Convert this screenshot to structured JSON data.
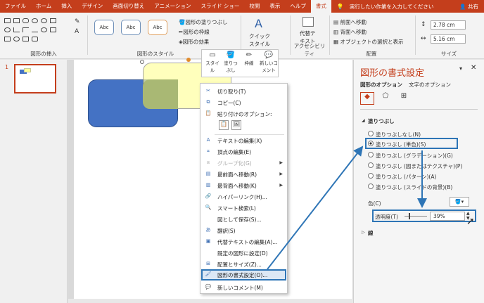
{
  "tabs": [
    "ファイル",
    "ホーム",
    "挿入",
    "デザイン",
    "画面切り替え",
    "アニメーション",
    "スライド ショー",
    "校閲",
    "表示",
    "ヘルプ",
    "書式"
  ],
  "tell_me": "実行したい作業を入力してください",
  "share": "共有",
  "ribbon": {
    "insert_group": "図形の挿入",
    "style_group": "図形のスタイル",
    "style_samples": [
      "Abc",
      "Abc",
      "Abc"
    ],
    "fill_btn": "図形の塗りつぶし",
    "outline_btn": "図形の枠線",
    "effect_btn": "図形の効果",
    "quick_style": "クイック\nスタイル",
    "alt_text": "代替テ\nキスト",
    "access_group": "アクセシビリティ",
    "forward": "前面へ移動",
    "backward": "背面へ移動",
    "select_pane": "オブジェクトの選択と表示",
    "arrange_group": "配置",
    "height": "2.78 cm",
    "width": "5.16 cm",
    "size_group": "サイズ"
  },
  "thumb_number": "1",
  "mini_toolbar": [
    "スタイル",
    "塗りつぶし",
    "枠線",
    "新しいコメント"
  ],
  "context_menu": {
    "cut": "切り取り(T)",
    "copy": "コピー(C)",
    "paste_opts": "貼り付けのオプション:",
    "edit_text": "テキストの編集(X)",
    "edit_points": "頂点の編集(E)",
    "group": "グループ化(G)",
    "bring_front": "最前面へ移動(R)",
    "send_back": "最背面へ移動(K)",
    "hyperlink": "ハイパーリンク(H)...",
    "smart_lookup": "スマート検索(L)",
    "save_picture": "図として保存(S)...",
    "translate": "翻訳(S)",
    "edit_alt": "代替テキストの編集(A)...",
    "set_default": "既定の図形に設定(D)",
    "size_position": "配置とサイズ(Z)...",
    "format_shape": "図形の書式設定(O)...",
    "new_comment": "新しいコメント(M)"
  },
  "pane": {
    "title": "図形の書式設定",
    "tab_shape": "図形のオプション",
    "tab_text": "文字のオプション",
    "fill_section": "塗りつぶし",
    "opts": [
      "塗りつぶしなし(N)",
      "塗りつぶし (単色)(S)",
      "塗りつぶし (グラデーション)(G)",
      "塗りつぶし (図またはテクスチャ)(P)",
      "塗りつぶし (パターン)(A)",
      "塗りつぶし (スライドの背景)(B)"
    ],
    "selected_index": 1,
    "color_label": "色(C)",
    "transparency_label": "透明度(T)",
    "transparency_value": "39%",
    "line_section": "線"
  },
  "colors": {
    "accent": "#c43e1c",
    "highlight": "#2e75b6",
    "blue_shape": "#4472c4",
    "yellow_shape": "#ffff99"
  }
}
